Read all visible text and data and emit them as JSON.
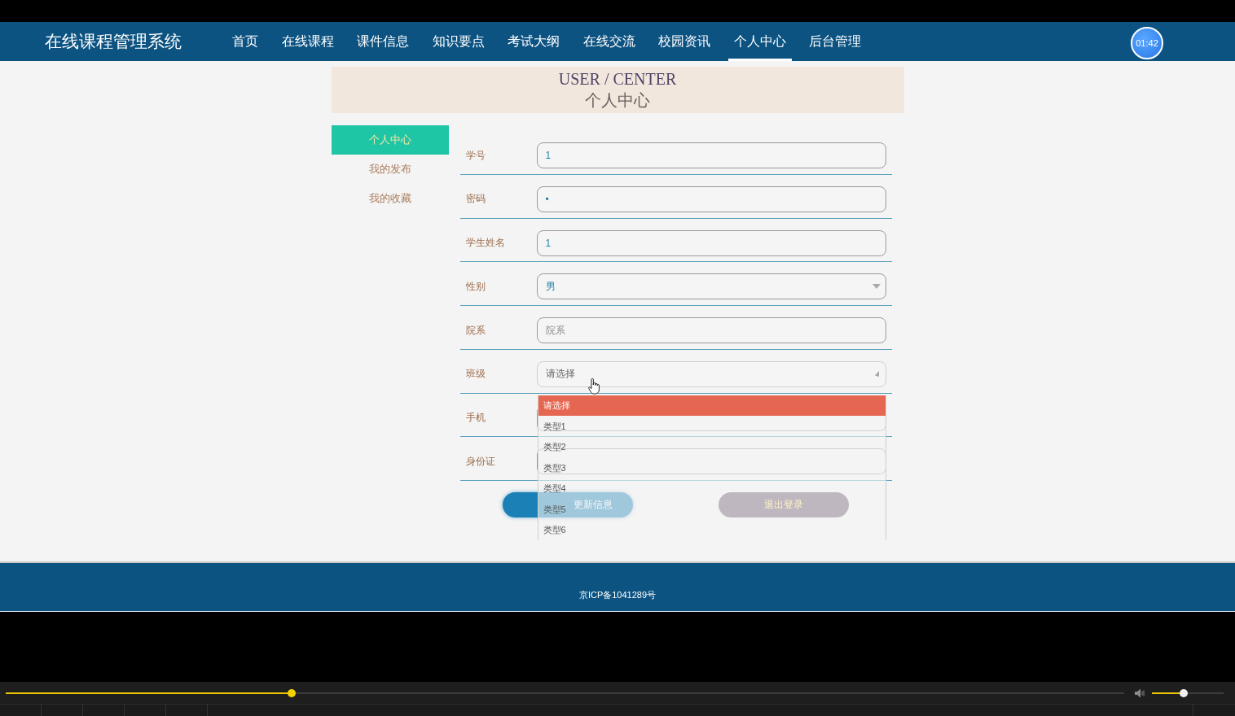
{
  "header": {
    "title": "在线课程管理系统",
    "nav": [
      {
        "label": "首页",
        "selected": false
      },
      {
        "label": "在线课程",
        "selected": false
      },
      {
        "label": "课件信息",
        "selected": false
      },
      {
        "label": "知识要点",
        "selected": false
      },
      {
        "label": "考试大纲",
        "selected": false
      },
      {
        "label": "在线交流",
        "selected": false
      },
      {
        "label": "校园资讯",
        "selected": false
      },
      {
        "label": "个人中心",
        "selected": true
      },
      {
        "label": "后台管理",
        "selected": false
      }
    ],
    "timer": "01:42"
  },
  "banner": {
    "title_en": "USER / CENTER",
    "title_zh": "个人中心"
  },
  "sidebar": {
    "items": [
      {
        "label": "个人中心",
        "selected": true
      },
      {
        "label": "我的发布",
        "selected": false
      },
      {
        "label": "我的收藏",
        "selected": false
      }
    ]
  },
  "form": {
    "fields": [
      {
        "label": "学号",
        "kind": "text",
        "value": "1"
      },
      {
        "label": "密码",
        "kind": "password",
        "value": "•"
      },
      {
        "label": "学生姓名",
        "kind": "text",
        "value": "1"
      },
      {
        "label": "性别",
        "kind": "select",
        "value": "男",
        "expanded": false
      },
      {
        "label": "院系",
        "kind": "text",
        "placeholder": "院系"
      },
      {
        "label": "班级",
        "kind": "select",
        "placeholder": "请选择",
        "expanded": true,
        "options": [
          {
            "label": "请选择",
            "selected": true
          },
          {
            "label": "类型1",
            "selected": false
          },
          {
            "label": "类型2",
            "selected": false
          },
          {
            "label": "类型3",
            "selected": false
          },
          {
            "label": "类型4",
            "selected": false
          },
          {
            "label": "类型5",
            "selected": false
          },
          {
            "label": "类型6",
            "selected": false
          }
        ]
      },
      {
        "label": "手机",
        "kind": "text"
      },
      {
        "label": "身份证",
        "kind": "text"
      }
    ],
    "buttons": [
      {
        "label": "更新信息",
        "kind": "primary"
      },
      {
        "label": "退出登录",
        "kind": "secondary"
      }
    ]
  },
  "footer": {
    "text": "京ICP备1041289号"
  },
  "player": {
    "progress": {
      "level": 0.256
    },
    "volume": {
      "level": 0.44
    }
  }
}
